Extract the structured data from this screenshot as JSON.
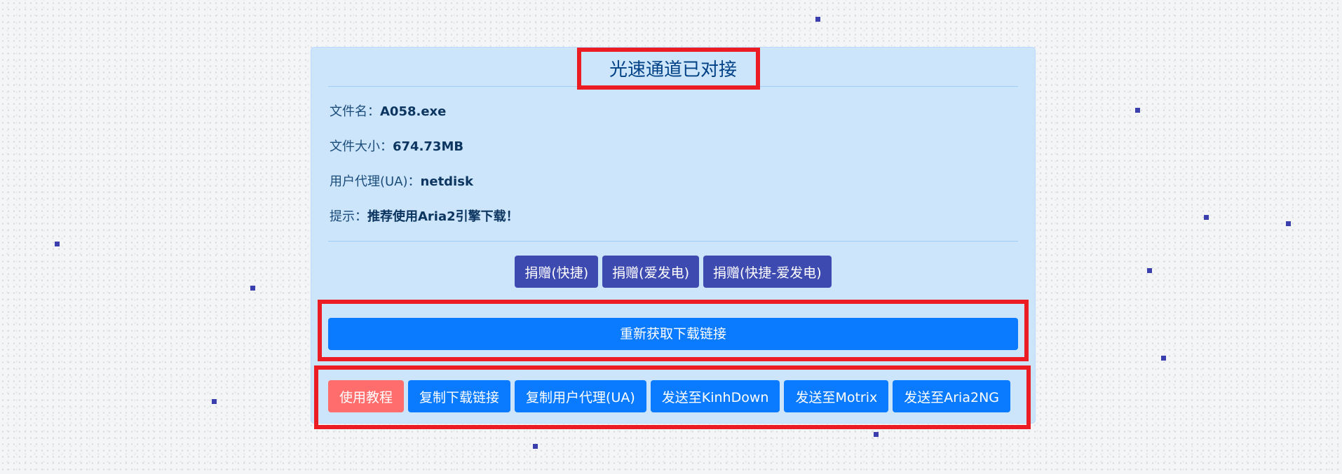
{
  "status": {
    "title": "光速通道已对接"
  },
  "file_info": {
    "filename_label": "文件名：",
    "filename_value": "A058.exe",
    "size_label": "文件大小：",
    "size_value": "674.73MB",
    "ua_label": "用户代理(UA)：",
    "ua_value": "netdisk",
    "tip_label": "提示：",
    "tip_value": "推荐使用Aria2引擎下载！"
  },
  "donate_buttons": [
    {
      "label": "捐赠(快捷)"
    },
    {
      "label": "捐赠(爱发电)"
    },
    {
      "label": "捐赠(快捷-爱发电)"
    }
  ],
  "refresh_button": {
    "label": "重新获取下载链接"
  },
  "action_buttons": [
    {
      "label": "使用教程"
    },
    {
      "label": "复制下载链接"
    },
    {
      "label": "复制用户代理(UA)"
    },
    {
      "label": "发送至KinhDown"
    },
    {
      "label": "发送至Motrix"
    },
    {
      "label": "发送至Aria2NG"
    }
  ],
  "colors": {
    "panel_background": "#cce5fb",
    "primary_button": "#0a7bff",
    "donate_button": "#3d4ab0",
    "tutorial_button": "#ff6e6c",
    "highlight_border": "#ec1c24"
  }
}
